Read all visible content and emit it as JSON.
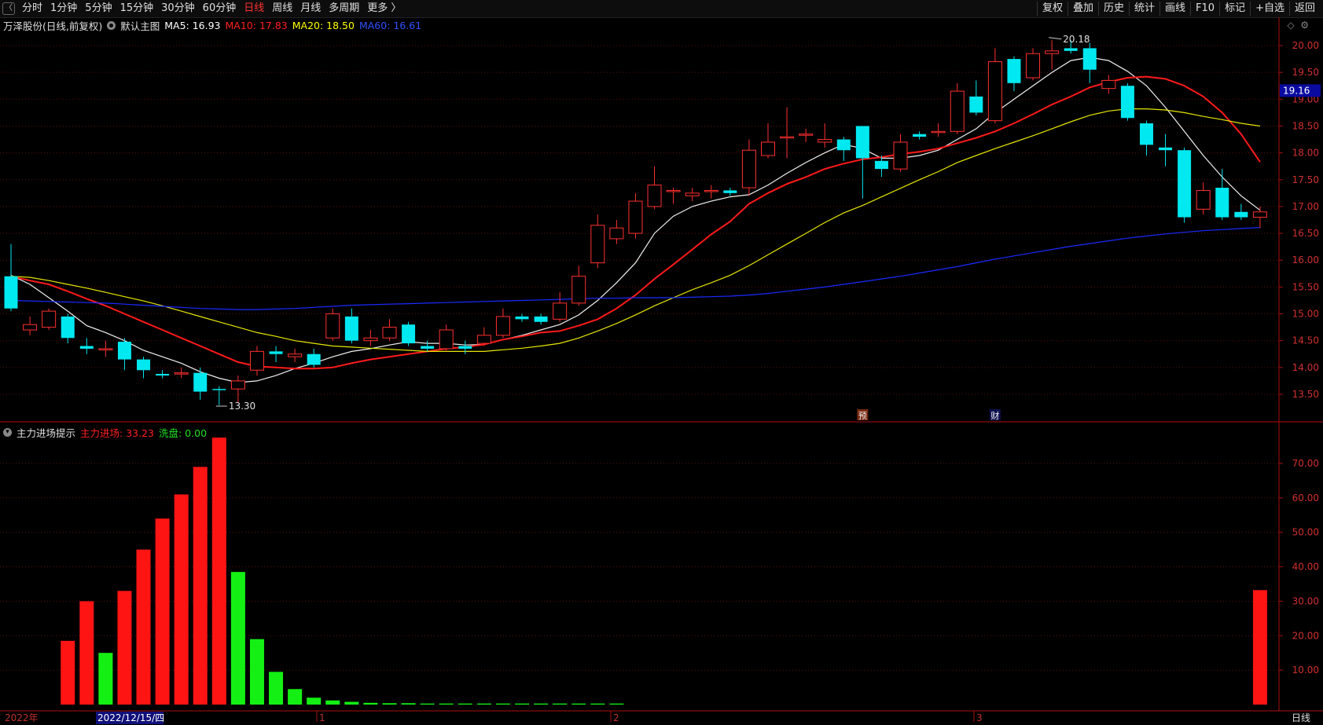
{
  "toolbar": {
    "periods": [
      "分时",
      "1分钟",
      "5分钟",
      "15分钟",
      "30分钟",
      "60分钟",
      "日线",
      "周线",
      "月线",
      "多周期",
      "更多 〉"
    ],
    "active_period": "日线",
    "actions": [
      "复权",
      "叠加",
      "历史",
      "统计",
      "画线",
      "F10",
      "标记",
      "+自选",
      "返回"
    ]
  },
  "main_panel": {
    "stock_label": "万泽股份(日线,前复权)",
    "template_label": "默认主图",
    "ma": [
      {
        "label": "MA5: 16.93",
        "color": "#ffffff"
      },
      {
        "label": "MA10: 17.83",
        "color": "#ff2020"
      },
      {
        "label": "MA20: 18.50",
        "color": "#ffff00"
      },
      {
        "label": "MA60: 16.61",
        "color": "#2040ff"
      }
    ],
    "icons": [
      "diamond-icon",
      "settings-icon"
    ]
  },
  "indicator_panel": {
    "name": "主力进场提示",
    "items": [
      {
        "label": "主力进场: 33.23",
        "color": "#ff2020"
      },
      {
        "label": "洗盘: 0.00",
        "color": "#20e020"
      }
    ]
  },
  "bottom_axis": {
    "labels": [
      "2022年",
      "2022/12/15/四",
      "1",
      "2",
      "3"
    ],
    "right_label": "日线"
  },
  "chart_data": [
    {
      "type": "candlestick",
      "y_axis": [
        13.5,
        14.0,
        14.5,
        15.0,
        15.5,
        16.0,
        16.5,
        17.0,
        17.5,
        18.0,
        18.5,
        19.0,
        19.5,
        20.0
      ],
      "ylim": [
        13.0,
        20.5
      ],
      "current_price": "19.16",
      "annotations": [
        {
          "text": "20.18",
          "kind": "high"
        },
        {
          "text": "13.30",
          "kind": "low"
        },
        {
          "text": "预",
          "kind": "event"
        },
        {
          "text": "财",
          "kind": "event"
        }
      ],
      "candles": [
        [
          15.7,
          15.1,
          16.3,
          15.05
        ],
        [
          14.7,
          14.8,
          14.6,
          14.95
        ],
        [
          14.75,
          15.05,
          14.7,
          15.1
        ],
        [
          14.95,
          14.55,
          15.0,
          14.45
        ],
        [
          14.4,
          14.35,
          14.55,
          14.25
        ],
        [
          14.35,
          14.35,
          14.5,
          14.2
        ],
        [
          14.48,
          14.15,
          14.55,
          13.95
        ],
        [
          14.15,
          13.95,
          14.2,
          13.8
        ],
        [
          13.88,
          13.85,
          13.95,
          13.8
        ],
        [
          13.9,
          13.9,
          14.0,
          13.8
        ],
        [
          13.9,
          13.55,
          14.0,
          13.4
        ],
        [
          13.6,
          13.58,
          13.65,
          13.3
        ],
        [
          13.6,
          13.75,
          13.85,
          13.35
        ],
        [
          13.95,
          14.3,
          14.4,
          13.85
        ],
        [
          14.3,
          14.25,
          14.4,
          14.1
        ],
        [
          14.2,
          14.25,
          14.35,
          14.1
        ],
        [
          14.25,
          14.05,
          14.35,
          14.0
        ],
        [
          14.55,
          15.0,
          15.1,
          14.5
        ],
        [
          14.95,
          14.5,
          15.1,
          14.45
        ],
        [
          14.5,
          14.55,
          14.7,
          14.4
        ],
        [
          14.55,
          14.75,
          14.9,
          14.5
        ],
        [
          14.8,
          14.45,
          14.85,
          14.4
        ],
        [
          14.4,
          14.35,
          14.5,
          14.3
        ],
        [
          14.35,
          14.7,
          14.8,
          14.3
        ],
        [
          14.4,
          14.35,
          14.5,
          14.25
        ],
        [
          14.45,
          14.6,
          14.75,
          14.4
        ],
        [
          14.6,
          14.95,
          15.1,
          14.55
        ],
        [
          14.95,
          14.9,
          15.0,
          14.85
        ],
        [
          14.95,
          14.85,
          15.0,
          14.8
        ],
        [
          14.9,
          15.2,
          15.4,
          14.85
        ],
        [
          15.2,
          15.7,
          15.9,
          15.15
        ],
        [
          15.95,
          16.65,
          16.85,
          15.85
        ],
        [
          16.4,
          16.6,
          16.75,
          16.3
        ],
        [
          16.5,
          17.1,
          17.25,
          16.4
        ],
        [
          17.0,
          17.4,
          17.75,
          16.95
        ],
        [
          17.3,
          17.3,
          17.35,
          17.05
        ],
        [
          17.2,
          17.25,
          17.35,
          17.1
        ],
        [
          17.3,
          17.3,
          17.4,
          17.15
        ],
        [
          17.3,
          17.25,
          17.35,
          17.2
        ],
        [
          17.35,
          18.05,
          18.25,
          17.2
        ],
        [
          17.95,
          18.2,
          18.55,
          17.9
        ],
        [
          18.3,
          18.3,
          18.85,
          17.9
        ],
        [
          18.35,
          18.35,
          18.45,
          18.2
        ],
        [
          18.2,
          18.25,
          18.55,
          18.1
        ],
        [
          18.25,
          18.05,
          18.3,
          17.85
        ],
        [
          18.5,
          17.9,
          18.5,
          17.15
        ],
        [
          17.85,
          17.7,
          17.95,
          17.55
        ],
        [
          17.7,
          18.2,
          18.35,
          17.65
        ],
        [
          18.35,
          18.3,
          18.4,
          18.25
        ],
        [
          18.4,
          18.4,
          18.55,
          18.3
        ],
        [
          18.4,
          19.15,
          19.3,
          18.35
        ],
        [
          19.05,
          18.75,
          19.35,
          18.7
        ],
        [
          18.6,
          19.7,
          19.95,
          18.55
        ],
        [
          19.75,
          19.3,
          19.8,
          19.15
        ],
        [
          19.4,
          19.85,
          19.95,
          19.35
        ],
        [
          19.85,
          19.9,
          20.1,
          19.55
        ],
        [
          19.95,
          19.9,
          20.1,
          19.85
        ],
        [
          19.95,
          19.55,
          20.05,
          19.3
        ],
        [
          19.2,
          19.35,
          19.45,
          19.1
        ],
        [
          19.25,
          18.65,
          19.3,
          18.6
        ],
        [
          18.55,
          18.15,
          18.6,
          17.95
        ],
        [
          18.1,
          18.05,
          18.35,
          17.75
        ],
        [
          18.05,
          16.8,
          18.1,
          16.7
        ],
        [
          16.95,
          17.3,
          17.45,
          16.85
        ],
        [
          17.35,
          16.8,
          17.7,
          16.75
        ],
        [
          16.9,
          16.8,
          17.05,
          16.75
        ],
        [
          16.8,
          16.9,
          17.0,
          16.6
        ]
      ],
      "series": [
        {
          "name": "MA5",
          "values": [
            15.72,
            15.55,
            15.3,
            15.05,
            14.78,
            14.65,
            14.5,
            14.32,
            14.2,
            14.08,
            13.92,
            13.8,
            13.72,
            13.75,
            13.85,
            13.98,
            14.08,
            14.2,
            14.3,
            14.35,
            14.42,
            14.48,
            14.45,
            14.45,
            14.42,
            14.43,
            14.52,
            14.6,
            14.7,
            14.8,
            14.98,
            15.25,
            15.58,
            15.95,
            16.5,
            16.82,
            17.0,
            17.1,
            17.18,
            17.22,
            17.4,
            17.62,
            17.82,
            18.0,
            18.16,
            18.08,
            17.9,
            17.9,
            17.95,
            18.05,
            18.25,
            18.45,
            18.75,
            19.0,
            19.25,
            19.5,
            19.72,
            19.78,
            19.72,
            19.52,
            19.25,
            18.85,
            18.4,
            17.95,
            17.55,
            17.2,
            16.93
          ]
        },
        {
          "name": "MA10",
          "values": [
            15.7,
            15.62,
            15.55,
            15.42,
            15.28,
            15.15,
            15.0,
            14.85,
            14.7,
            14.55,
            14.4,
            14.25,
            14.1,
            14.02,
            14.0,
            13.98,
            13.98,
            14.0,
            14.08,
            14.15,
            14.2,
            14.25,
            14.3,
            14.35,
            14.38,
            14.43,
            14.52,
            14.58,
            14.65,
            14.68,
            14.78,
            14.9,
            15.1,
            15.35,
            15.65,
            15.92,
            16.2,
            16.48,
            16.72,
            17.05,
            17.25,
            17.42,
            17.55,
            17.7,
            17.8,
            17.88,
            17.92,
            17.98,
            18.02,
            18.08,
            18.18,
            18.28,
            18.4,
            18.55,
            18.72,
            18.9,
            19.05,
            19.22,
            19.32,
            19.4,
            19.42,
            19.38,
            19.25,
            19.05,
            18.75,
            18.35,
            17.83
          ]
        },
        {
          "name": "MA20",
          "values": [
            15.7,
            15.68,
            15.62,
            15.55,
            15.48,
            15.4,
            15.32,
            15.24,
            15.15,
            15.05,
            14.95,
            14.85,
            14.75,
            14.65,
            14.58,
            14.5,
            14.45,
            14.4,
            14.38,
            14.36,
            14.34,
            14.32,
            14.3,
            14.3,
            14.3,
            14.3,
            14.33,
            14.36,
            14.4,
            14.45,
            14.55,
            14.68,
            14.82,
            14.98,
            15.15,
            15.3,
            15.45,
            15.58,
            15.72,
            15.9,
            16.1,
            16.3,
            16.5,
            16.7,
            16.88,
            17.02,
            17.18,
            17.34,
            17.5,
            17.65,
            17.82,
            17.95,
            18.08,
            18.2,
            18.32,
            18.45,
            18.58,
            18.7,
            18.78,
            18.82,
            18.82,
            18.8,
            18.75,
            18.68,
            18.62,
            18.55,
            18.5
          ]
        },
        {
          "name": "MA60",
          "values": [
            15.25,
            15.24,
            15.23,
            15.22,
            15.21,
            15.2,
            15.18,
            15.16,
            15.14,
            15.12,
            15.1,
            15.09,
            15.08,
            15.08,
            15.09,
            15.1,
            15.12,
            15.14,
            15.16,
            15.17,
            15.18,
            15.19,
            15.2,
            15.21,
            15.22,
            15.23,
            15.24,
            15.25,
            15.26,
            15.27,
            15.28,
            15.29,
            15.29,
            15.3,
            15.3,
            15.3,
            15.31,
            15.32,
            15.33,
            15.35,
            15.38,
            15.42,
            15.46,
            15.5,
            15.55,
            15.6,
            15.65,
            15.7,
            15.76,
            15.82,
            15.88,
            15.95,
            16.02,
            16.08,
            16.14,
            16.2,
            16.26,
            16.31,
            16.36,
            16.41,
            16.45,
            16.49,
            16.52,
            16.55,
            16.57,
            16.59,
            16.61
          ]
        }
      ]
    },
    {
      "type": "bar",
      "y_axis": [
        10.0,
        20.0,
        30.0,
        40.0,
        50.0,
        60.0,
        70.0
      ],
      "ylim": [
        0,
        80
      ],
      "series": [
        {
          "name": "主力进场",
          "values": [
            0,
            0,
            0,
            18.5,
            30,
            0,
            33,
            45,
            54,
            61,
            69,
            77.5,
            0,
            0,
            0,
            0,
            0,
            0,
            0,
            0,
            0,
            0,
            0,
            0,
            0,
            0,
            0,
            0,
            0,
            0,
            0,
            0,
            0,
            0,
            0,
            0,
            0,
            0,
            0,
            0,
            0,
            0,
            0,
            0,
            0,
            0,
            0,
            0,
            0,
            0,
            0,
            0,
            0,
            0,
            0,
            0,
            0,
            0,
            0,
            0,
            0,
            0,
            0,
            0,
            0,
            0,
            33.23
          ]
        },
        {
          "name": "洗盘",
          "values": [
            0,
            0,
            0,
            0,
            0,
            15,
            0,
            0,
            0,
            0,
            0,
            0,
            38.5,
            19,
            9.5,
            4.5,
            2,
            1.2,
            0.8,
            0.5,
            0.4,
            0.4,
            0.3,
            0.3,
            0.3,
            0.3,
            0.3,
            0.3,
            0.3,
            0.3,
            0.3,
            0.3,
            0.3,
            0,
            0,
            0,
            0,
            0,
            0,
            0,
            0,
            0,
            0,
            0,
            0,
            0,
            0,
            0,
            0,
            0,
            0,
            0,
            0,
            0,
            0,
            0,
            0,
            0,
            0,
            0,
            0,
            0,
            0,
            0,
            0,
            0,
            0
          ]
        }
      ]
    }
  ]
}
